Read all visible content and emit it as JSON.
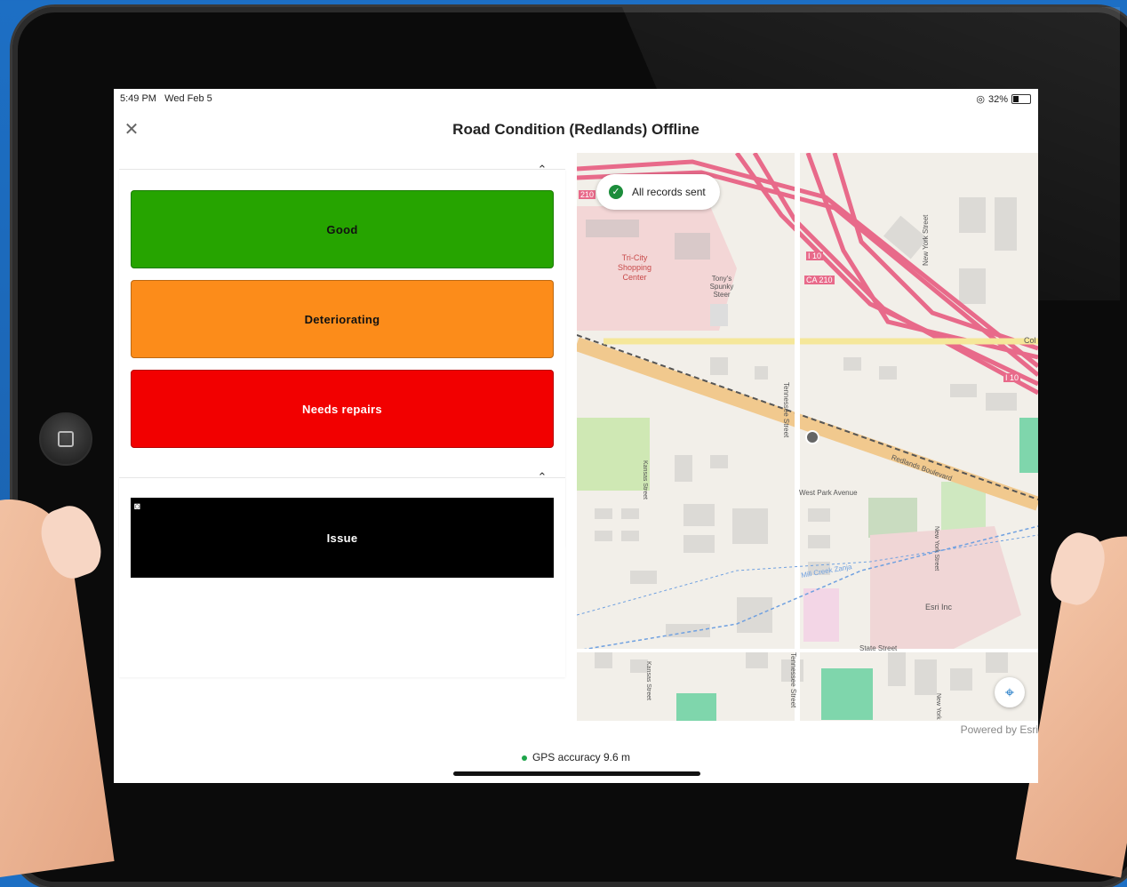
{
  "statusbar": {
    "time": "5:49 PM",
    "date": "Wed Feb 5",
    "battery": "32%"
  },
  "header": {
    "title": "Road Condition (Redlands) Offline"
  },
  "condition_buttons": [
    {
      "label": "Good",
      "color": "#26a400"
    },
    {
      "label": "Deteriorating",
      "color": "#fc8c1a"
    },
    {
      "label": "Needs repairs",
      "color": "#f20000"
    }
  ],
  "issue_button": {
    "label": "Issue"
  },
  "map": {
    "toast": "All records sent",
    "attribution": "Powered by Esri",
    "labels": {
      "i210": "210",
      "shopping": "Tri-City Shopping Center",
      "tonys": "Tony's Spunky Steer",
      "i10a": "I 10",
      "ca210": "CA 210",
      "i10b": "I 10",
      "ny1": "New York Street",
      "col": "Col",
      "tennessee1": "Tennessee Street",
      "redlands": "Redlands Boulevard",
      "kansas1": "Kansas Street",
      "westpark": "West Park Avenue",
      "mill": "Mill Creek Zanja",
      "ny2": "New York Street",
      "esri": "Esri Inc",
      "state": "State Street",
      "kansas2": "Kansas Street",
      "tennessee2": "Tennessee Street",
      "ny3": "New York"
    }
  },
  "footer": {
    "gps": "GPS accuracy 9.6 m"
  },
  "icons": {
    "close": "close-icon",
    "collapse": "chevron-up-icon",
    "camera": "camera-icon",
    "locate": "locate-icon",
    "check": "check-circle-icon"
  }
}
